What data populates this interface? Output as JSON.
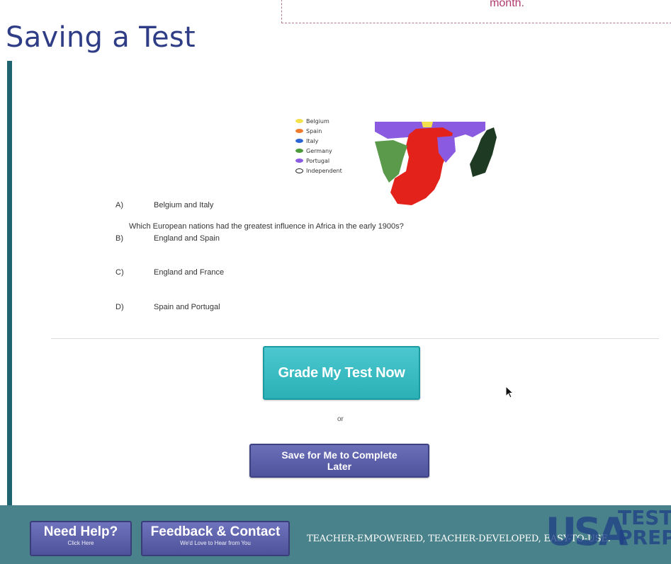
{
  "slide": {
    "title": "Saving a Test",
    "callout_text": "month."
  },
  "map": {
    "legend": [
      {
        "label": "Belgium",
        "color": "#f2e14c"
      },
      {
        "label": "Spain",
        "color": "#f07a2c"
      },
      {
        "label": "Italy",
        "color": "#2c64d6"
      },
      {
        "label": "Germany",
        "color": "#4d9a3c"
      },
      {
        "label": "Portugal",
        "color": "#8a5ae0"
      },
      {
        "label": "Independent",
        "color": "#ffffff"
      }
    ],
    "colors": {
      "england": "#e3231b",
      "france": "#8a5ae0",
      "germany": "#5a9a4a",
      "madagascar": "#1f3a22",
      "portugal": "#8a5ae0"
    }
  },
  "question": {
    "text": "Which European nations had the greatest influence in Africa in the early 1900s?",
    "answers": [
      {
        "letter": "A)",
        "text": "Belgium and Italy"
      },
      {
        "letter": "B)",
        "text": "England and Spain"
      },
      {
        "letter": "C)",
        "text": "England and France"
      },
      {
        "letter": "D)",
        "text": "Spain and Portugal"
      }
    ]
  },
  "actions": {
    "grade_label": "Grade My Test Now",
    "or_label": "or",
    "save_label": "Save for Me to Complete Later"
  },
  "footer": {
    "help_label": "Need Help?",
    "help_sub": "Click Here",
    "feedback_label": "Feedback & Contact",
    "feedback_sub": "We'd Love to Hear from You",
    "tagline": "TEACHER-EMPOWERED, TEACHER-DEVELOPED, EASY-TO-USE.",
    "logo_main": "USA",
    "logo_test": "TEST",
    "logo_prep": "PREP"
  }
}
